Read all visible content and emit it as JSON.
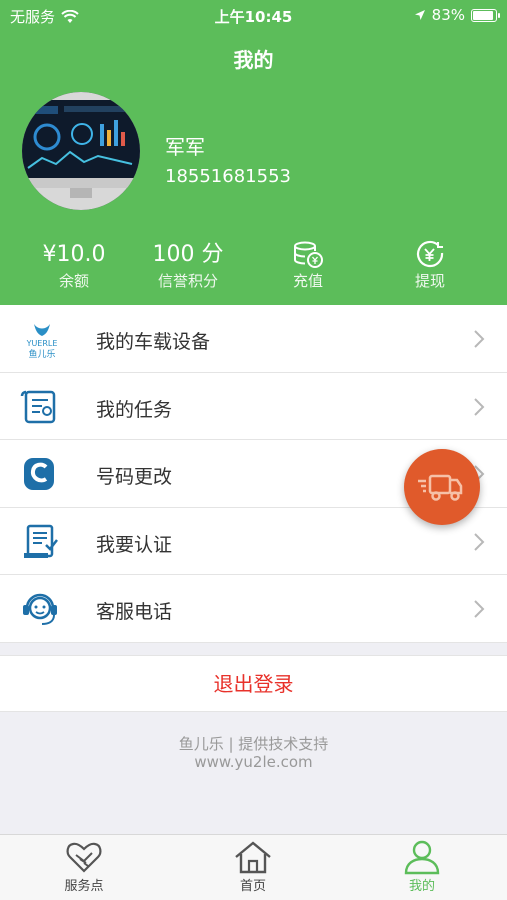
{
  "status_bar": {
    "carrier": "无服务",
    "time": "上午10:45",
    "battery": "83%"
  },
  "header": {
    "title": "我的"
  },
  "user": {
    "name": "军军",
    "phone": "18551681553"
  },
  "stats": [
    {
      "value": "¥10.0",
      "label": "余额"
    },
    {
      "value": "100 分",
      "label": "信誉积分"
    },
    {
      "icon": "database-coin-icon",
      "label": "充值"
    },
    {
      "icon": "withdraw-yen-icon",
      "label": "提现"
    }
  ],
  "menu": [
    {
      "label": "我的车载设备",
      "icon": "yuerle-logo-icon",
      "logo_text": "YUERLE",
      "logo_sub": "鱼儿乐"
    },
    {
      "label": "我的任务",
      "icon": "task-scroll-icon"
    },
    {
      "label": "号码更改",
      "icon": "phone-change-icon"
    },
    {
      "label": "我要认证",
      "icon": "certificate-icon"
    },
    {
      "label": "客服电话",
      "icon": "headset-icon"
    }
  ],
  "logout_label": "退出登录",
  "footer": {
    "line1": "鱼儿乐 | 提供技术支持",
    "line2": "www.yu2le.com"
  },
  "tabbar": [
    {
      "label": "服务点",
      "icon": "handshake-icon"
    },
    {
      "label": "首页",
      "icon": "home-icon"
    },
    {
      "label": "我的",
      "icon": "user-icon",
      "active": true
    }
  ],
  "colors": {
    "brand_green": "#5cbd5a",
    "logout_red": "#e8312a",
    "fab_orange": "#e05a2b",
    "icon_blue": "#1e6fa8"
  }
}
